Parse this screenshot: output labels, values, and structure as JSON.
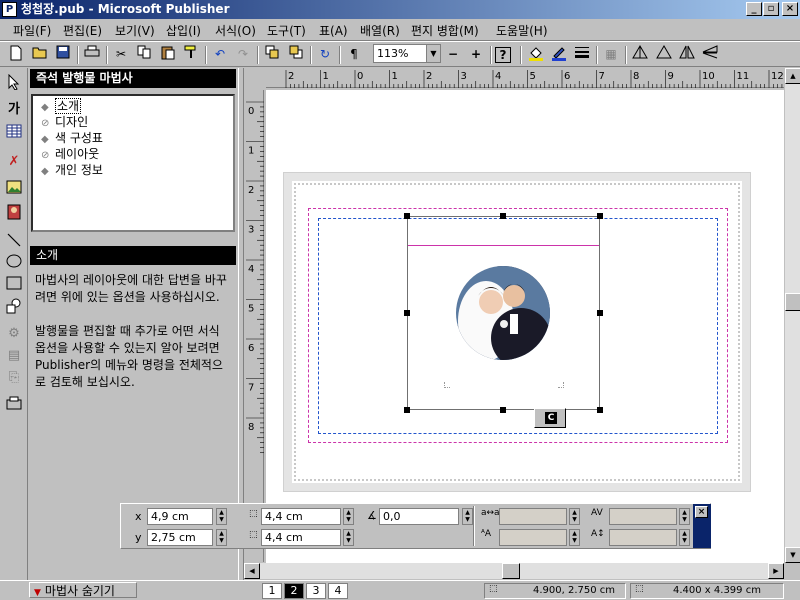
{
  "window": {
    "title": "청첩장.pub - Microsoft Publisher",
    "app_icon": "publisher-icon"
  },
  "menu": [
    {
      "label": "파일(F)"
    },
    {
      "label": "편집(E)"
    },
    {
      "label": "보기(V)"
    },
    {
      "label": "삽입(I)"
    },
    {
      "label": "서식(O)"
    },
    {
      "label": "도구(T)"
    },
    {
      "label": "표(A)"
    },
    {
      "label": "배열(R)"
    },
    {
      "label": "편지 병합(M)"
    },
    {
      "label": "도움말(H)"
    }
  ],
  "toolbar": {
    "zoom_value": "113%",
    "para_mark": "¶",
    "zoom_out": "−",
    "zoom_in": "+",
    "help": "?"
  },
  "wizard": {
    "title": "즉석 발행물 마법사",
    "items": [
      {
        "label": "소개",
        "icon": "diamond-bullet"
      },
      {
        "label": "디자인",
        "icon": "no-sign"
      },
      {
        "label": "색 구성표",
        "icon": "diamond-bullet"
      },
      {
        "label": "레이아웃",
        "icon": "no-sign"
      },
      {
        "label": "개인 정보",
        "icon": "diamond-bullet"
      }
    ],
    "section_title": "소개",
    "intro_p1": "마법사의 레이아웃에 대한 답변을 바꾸려면 위에 있는 옵션을 사용하십시오.",
    "intro_p2": "발행물을 편집할 때 추가로 어떤 서식 옵션을 사용할 수 있는지 알아 보려면 Publisher의 메뉴와 명령을 전체적으로 검토해 보십시오.",
    "hide_label": "마법사 숨기기"
  },
  "ruler": {
    "h_labels": [
      "2",
      "1",
      "0",
      "1",
      "2",
      "3",
      "4",
      "5",
      "6",
      "7",
      "8",
      "9",
      "10",
      "11",
      "12",
      "13",
      "14"
    ],
    "v_labels": [
      "0",
      "1",
      "2",
      "3",
      "4",
      "5",
      "6",
      "7",
      "8"
    ]
  },
  "measurements": {
    "x_label": "x",
    "x_value": "4,9 cm",
    "y_label": "y",
    "y_value": "2,75 cm",
    "w_value": "4,4 cm",
    "h_value": "4,4 cm",
    "angle_value": "0,0"
  },
  "pages": [
    "1",
    "2",
    "3",
    "4"
  ],
  "active_page": "2",
  "status": {
    "position": "4.900, 2.750 cm",
    "size": "4.400 x 4.399 cm"
  },
  "colors": {
    "accent": "#0a246a",
    "guide_pink": "#cc33aa",
    "guide_blue": "#2255cc"
  }
}
